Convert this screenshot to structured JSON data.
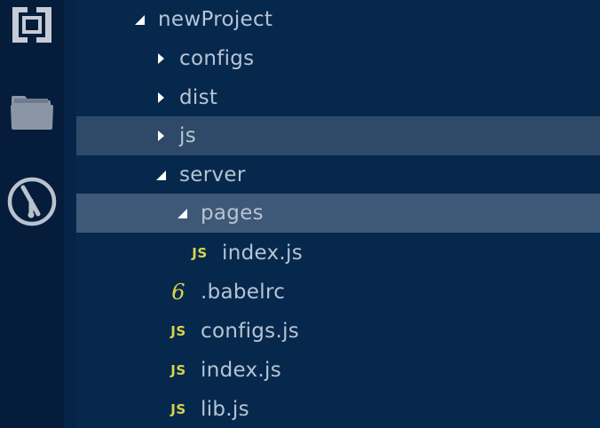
{
  "activity_bar": {
    "icons": [
      "brackets-logo-icon",
      "folder-icon",
      "git-icon"
    ]
  },
  "tree": {
    "root": "newProject",
    "configs_folder": "configs",
    "dist_folder": "dist",
    "js_folder": "js",
    "server_folder": "server",
    "pages_folder": "pages",
    "pages_index": "index.js",
    "babelrc": ".babelrc",
    "configs_js": "configs.js",
    "index_js": "index.js",
    "lib_js": "lib.js"
  },
  "badges": {
    "js": "JS",
    "babel": "6"
  },
  "colors": {
    "background": "#06284d",
    "activity_bar": "#051d3a",
    "row_highlight": "#2f4a68",
    "row_selected": "#3e5877",
    "text": "#b7c4d3",
    "icon_yellow": "#d8d44a"
  }
}
